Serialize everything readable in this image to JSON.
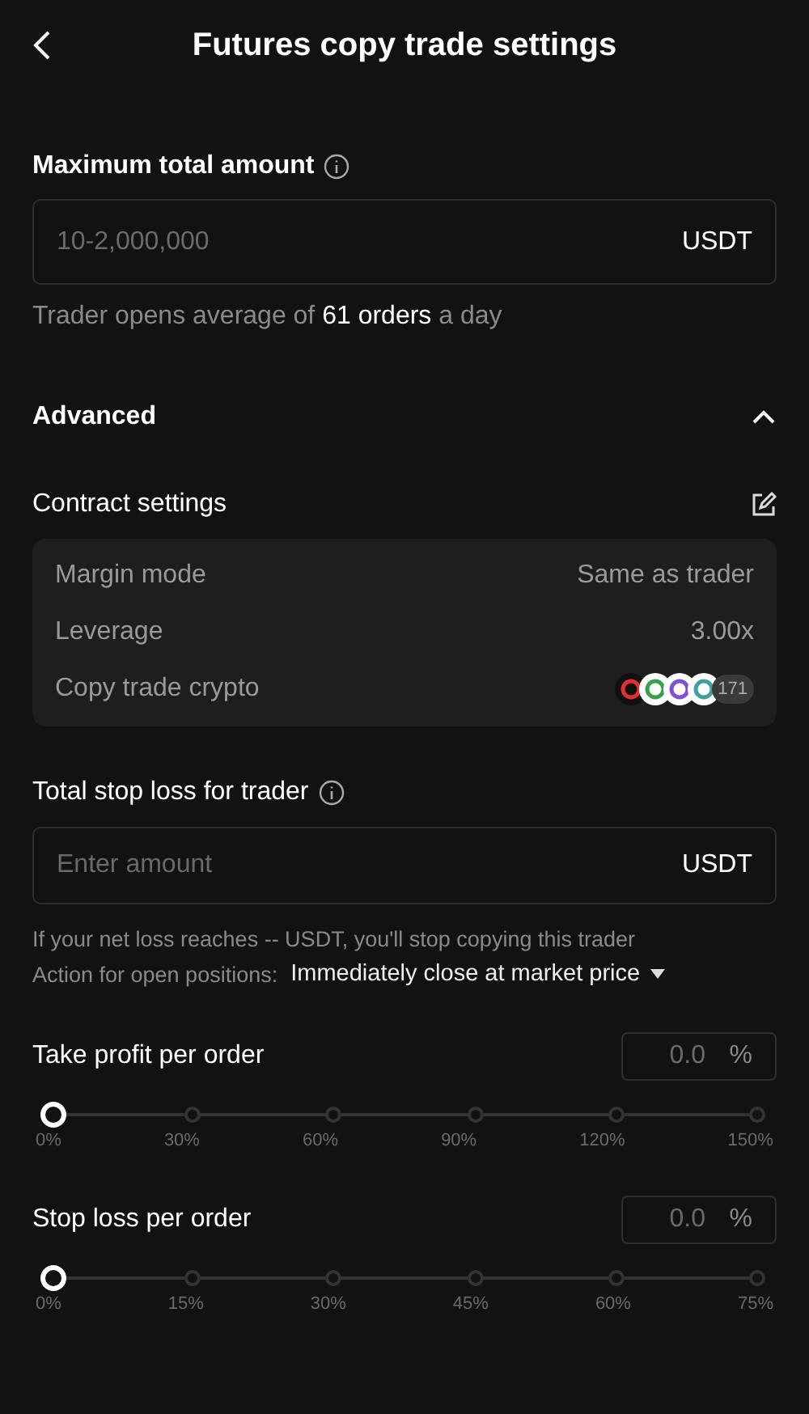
{
  "header": {
    "title": "Futures copy trade settings"
  },
  "max_amount": {
    "label": "Maximum total amount",
    "placeholder": "10-2,000,000",
    "unit": "USDT",
    "note": "Trader opens average of **61 orders** a day"
  },
  "advanced": {
    "title": "Advanced",
    "expanded": true
  },
  "contract": {
    "title": "Contract settings",
    "rows": [
      {
        "kind": "text",
        "label": "Margin mode",
        "value": "Same as trader"
      },
      {
        "kind": "text",
        "label": "Leverage",
        "value": "3.00x"
      },
      {
        "kind": "coins",
        "label": "Copy trade crypto",
        "count": "171"
      }
    ]
  },
  "stop_loss_total": {
    "label": "Total stop loss for trader",
    "placeholder": "Enter amount",
    "unit": "USDT",
    "note": "If your net loss reaches -- USDT, you'll stop copying this trader",
    "action_label": "Action for open positions:",
    "action_value": "Immediately close at market price"
  },
  "sliders": [
    {
      "label": "Take profit per order",
      "placeholder": "0.0",
      "unit": "%",
      "level": 0,
      "ticks": [
        "0%",
        "30%",
        "60%",
        "90%",
        "120%",
        "150%"
      ]
    },
    {
      "label": "Stop loss per order",
      "placeholder": "0.0",
      "unit": "%",
      "level": 0,
      "ticks": [
        "0%",
        "15%",
        "30%",
        "45%",
        "60%",
        "75%"
      ]
    }
  ]
}
